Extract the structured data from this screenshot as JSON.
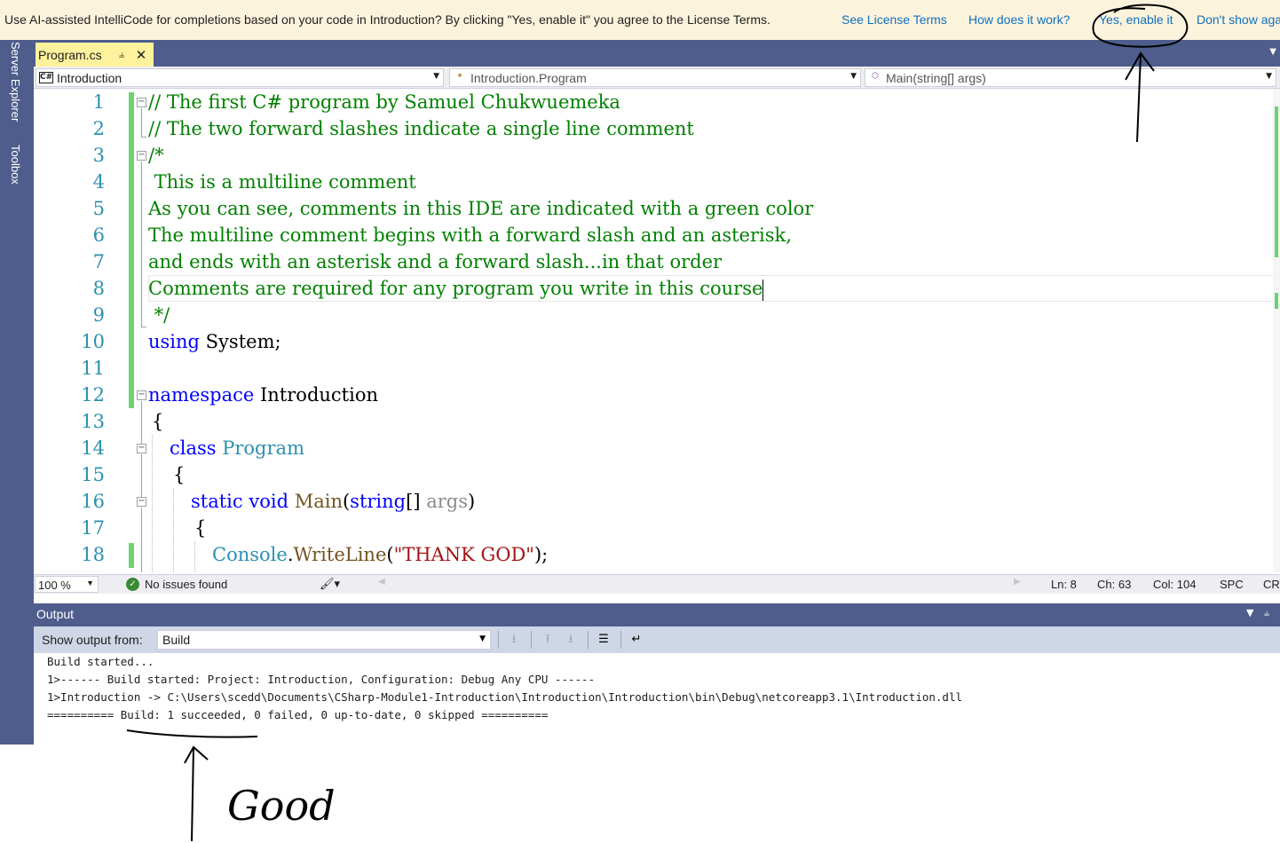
{
  "infobar": {
    "message": "Use AI-assisted IntelliCode for completions based on your code in Introduction?  By clicking \"Yes, enable it\" you agree to the License Terms.",
    "see_license": "See License Terms",
    "how_works": "How does it work?",
    "enable": "Yes, enable it",
    "dont_show": "Don't show again"
  },
  "sidebar": {
    "server_explorer": "Server Explorer",
    "toolbox": "Toolbox"
  },
  "document_tab": {
    "name": "Program.cs",
    "pin_icon": "pin-icon",
    "close_icon": "close-icon"
  },
  "navbar": {
    "project": "Introduction",
    "type": "Introduction.Program",
    "member": "Main(string[] args)"
  },
  "editor": {
    "line_numbers": [
      "1",
      "2",
      "3",
      "4",
      "5",
      "6",
      "7",
      "8",
      "9",
      "10",
      "11",
      "12",
      "13",
      "14",
      "15",
      "16",
      "17",
      "18"
    ],
    "lines": {
      "l1": "// The first C# program by Samuel Chukwuemeka",
      "l2": "// The two forward slashes indicate a single line comment",
      "l3": "/*",
      "l4": " This is a multiline comment",
      "l5": "As you can see, comments in this IDE are indicated with a green color",
      "l6": "The multiline comment begins with a forward slash and an asterisk,",
      "l7": "and ends with an asterisk and a forward slash...in that order",
      "l8": "Comments are required for any program you write in this course",
      "l9": " */",
      "l10_kw": "using",
      "l10_rest": " System;",
      "l12_kw": "namespace",
      "l12_rest": " Introduction",
      "l13": "{",
      "l14_kw": "class",
      "l14_type": "Program",
      "l15": "{",
      "l16_kw1": "static",
      "l16_kw2": "void",
      "l16_method": "Main",
      "l16_open": "(",
      "l16_kw3": "string",
      "l16_brackets": "[] ",
      "l16_param": "args",
      "l16_close": ")",
      "l17": "{",
      "l18_type": "Console",
      "l18_dot": ".",
      "l18_method": "WriteLine",
      "l18_open": "(",
      "l18_str": "\"THANK GOD\"",
      "l18_close": ");"
    }
  },
  "status": {
    "zoom": "100 %",
    "issues": "No issues found",
    "ln": "Ln: 8",
    "ch": "Ch: 63",
    "col": "Col: 104",
    "spc": "SPC",
    "crlf": "CRLF"
  },
  "output": {
    "title": "Output",
    "show_from_label": "Show output from:",
    "source": "Build",
    "lines": [
      "Build started...",
      "1>------ Build started: Project: Introduction, Configuration: Debug Any CPU ------",
      "1>Introduction -> C:\\Users\\scedd\\Documents\\CSharp-Module1-Introduction\\Introduction\\Introduction\\bin\\Debug\\netcoreapp3.1\\Introduction.dll",
      "========== Build: 1 succeeded, 0 failed, 0 up-to-date, 0 skipped =========="
    ]
  },
  "annotation": {
    "handwritten_word": "Good"
  },
  "colors": {
    "comment": "#008000",
    "keyword": "#0000ff",
    "type": "#2b91af",
    "string": "#a31515",
    "dock": "#4f5d8d",
    "active_tab": "#fff29d",
    "infobar": "#fcf3dd",
    "link": "#0e70c0"
  }
}
